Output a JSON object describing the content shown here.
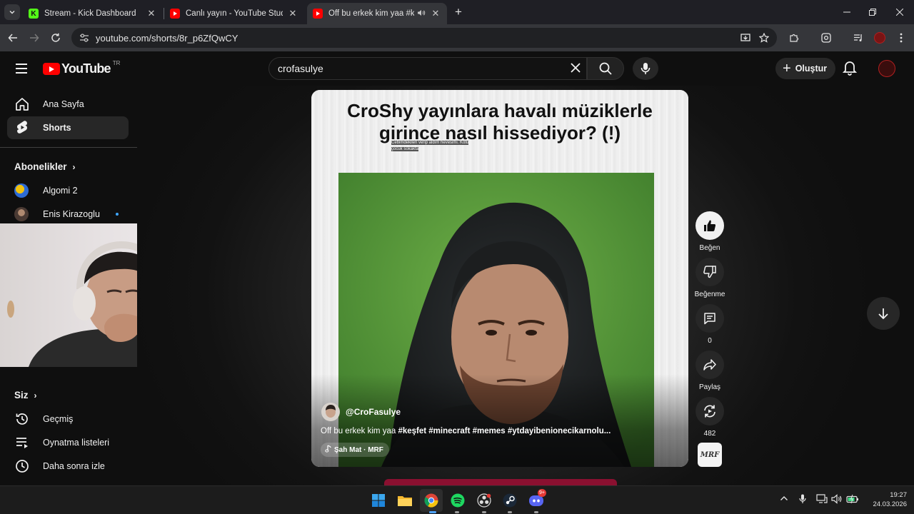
{
  "browser": {
    "tabs": [
      {
        "title": "Stream - Kick Dashboard",
        "icon": "kick-icon",
        "icon_color": "#53fc18"
      },
      {
        "title": "Canlı yayın - YouTube Studio",
        "icon": "youtube-studio-icon",
        "icon_color": "#ff0000"
      },
      {
        "title": "Off bu erkek kim yaa #keşfet",
        "icon": "youtube-icon",
        "icon_color": "#ff0000",
        "active": true,
        "audio": true
      }
    ],
    "url": "youtube.com/shorts/8r_p6ZfQwCY"
  },
  "youtube": {
    "logo_text": "YouTube",
    "country_code": "TR",
    "search": {
      "query": "crofasulye"
    },
    "create_label": "Oluştur"
  },
  "sidebar": {
    "items": [
      {
        "label": "Ana Sayfa",
        "icon": "home-icon"
      },
      {
        "label": "Shorts",
        "icon": "shorts-icon",
        "active": true
      }
    ],
    "subscriptions_heading": "Abonelikler",
    "subscriptions": [
      {
        "name": "Algomi 2",
        "avatar_color": "#f2c20c"
      },
      {
        "name": "Enis Kirazoglu",
        "avatar_color": "#6b5a4e",
        "live": true
      }
    ],
    "you_heading": "Siz",
    "you_items": [
      {
        "label": "Geçmiş",
        "icon": "history-icon"
      },
      {
        "label": "Oynatma listeleri",
        "icon": "playlists-icon"
      },
      {
        "label": "Daha sonra izle",
        "icon": "watch-later-icon"
      }
    ]
  },
  "short": {
    "headline_line1": "CroShy yayınlara havalı müziklerle",
    "headline_line2": "girince nasıl hissediyor? (!)",
    "small_caption": "Cebimdekileri verip aldım hevesimi. Kötü çocuk sokakta",
    "channel_handle": "@CroFasulye",
    "caption_plain": "Off bu erkek kim yaa ",
    "caption_tags": "#keşfet #minecraft #memes #ytdayibenionecikarnolu...",
    "music": "Şah Mat · MRF",
    "sound_tile_text": "MRF"
  },
  "actions": {
    "like_label": "Beğen",
    "dislike_label": "Beğenme",
    "comments_count": "0",
    "share_label": "Paylaş",
    "remix_count": "482"
  },
  "taskbar": {
    "time": "19:27",
    "date": "24.03.2026",
    "discord_badge": "9+"
  }
}
